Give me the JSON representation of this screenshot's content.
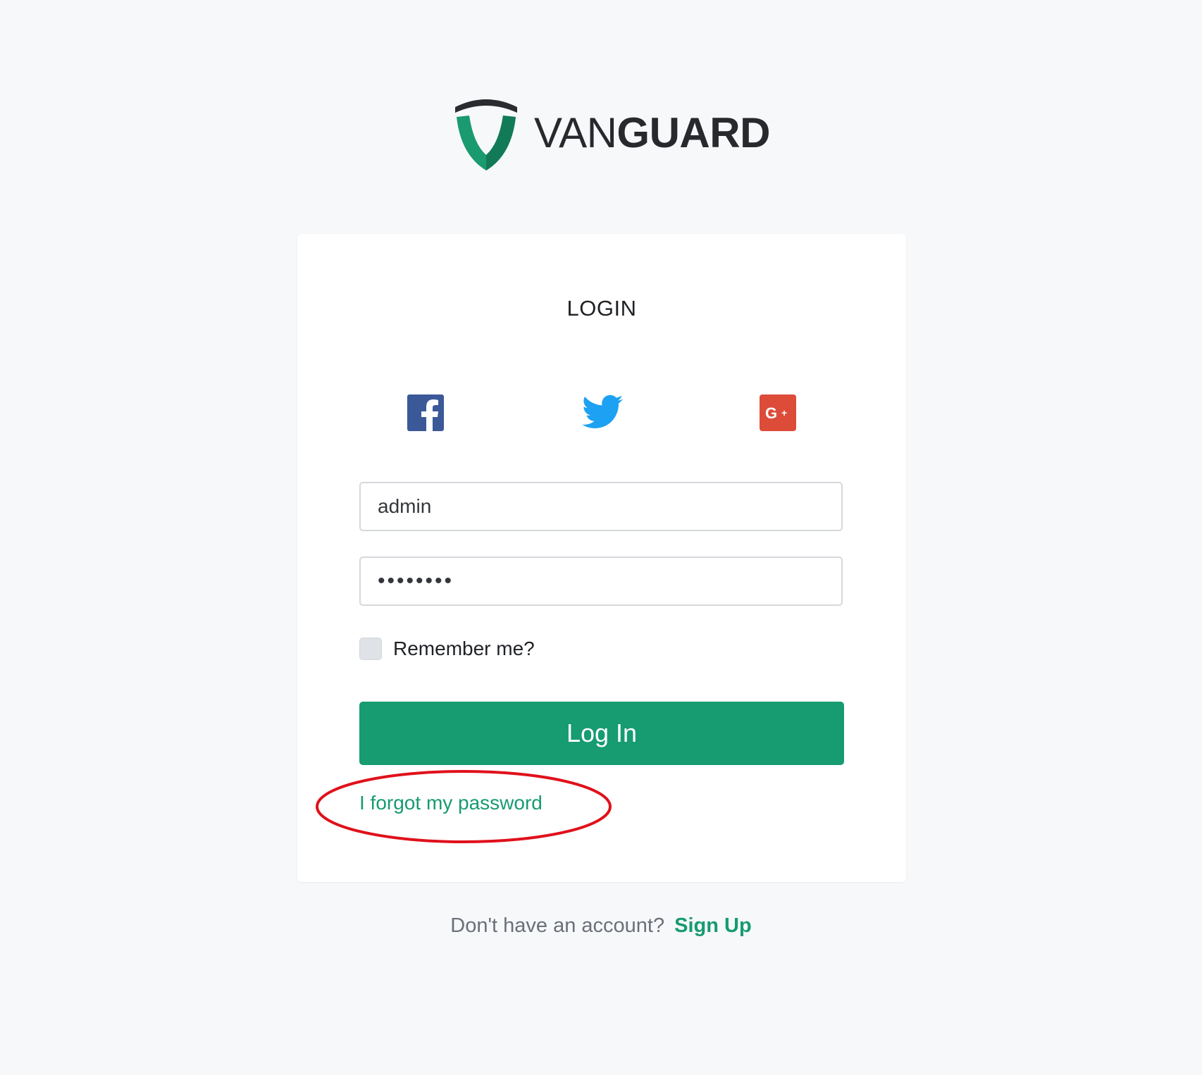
{
  "brand": {
    "name_light": "VAN",
    "name_bold": "GUARD",
    "logo_icon": "shield-icon",
    "colors": {
      "accent": "#179b71",
      "text_dark": "#27292c",
      "background": "#f7f8fa"
    }
  },
  "login_card": {
    "title": "LOGIN",
    "social": [
      {
        "name": "facebook",
        "icon": "facebook-icon",
        "color": "#3b5998"
      },
      {
        "name": "twitter",
        "icon": "twitter-icon",
        "color": "#1da1f2"
      },
      {
        "name": "google-plus",
        "icon": "google-plus-icon",
        "color": "#dd4b39"
      }
    ],
    "username": {
      "value": "admin"
    },
    "password": {
      "value": "••••••••"
    },
    "remember": {
      "label": "Remember me?",
      "checked": false
    },
    "submit_label": "Log In",
    "forgot_label": "I forgot my password"
  },
  "footer": {
    "prompt": "Don't have an account?",
    "signup_label": "Sign Up"
  },
  "annotation": {
    "color": "#e0111b"
  }
}
